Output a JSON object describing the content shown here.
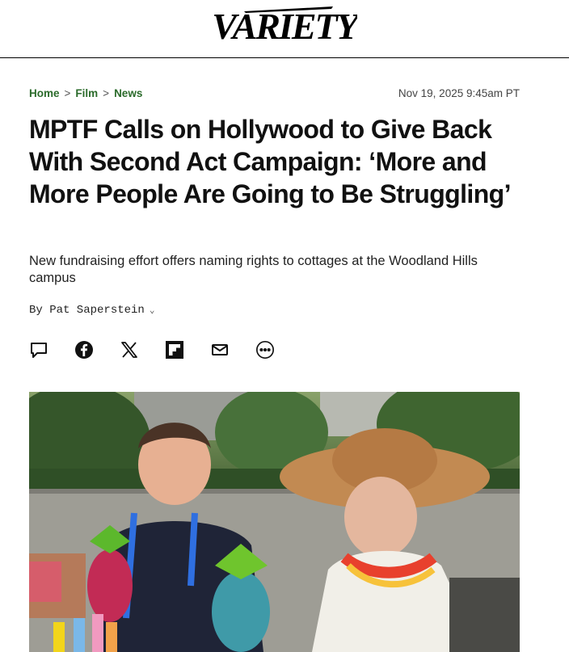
{
  "brand": {
    "name": "VARIETY"
  },
  "breadcrumb": {
    "items": [
      "Home",
      "Film",
      "News"
    ],
    "separator": ">"
  },
  "article": {
    "date": "Nov 19, 2025 9:45am PT",
    "headline": "MPTF Calls on Hollywood to Give Back With Second Act Campaign: ‘More and More People Are Going to Be Struggling’",
    "dek": "New fundraising effort offers naming rights to cottages at the Woodland Hills campus",
    "byline": "By Pat Saperstein",
    "byline_toggle": "⌄"
  },
  "share_icons": [
    "comment-icon",
    "facebook-icon",
    "x-icon",
    "flipboard-icon",
    "email-icon",
    "more-icon"
  ],
  "colors": {
    "breadcrumb": "#2b6b2b",
    "text": "#111111",
    "rule": "#000000"
  }
}
